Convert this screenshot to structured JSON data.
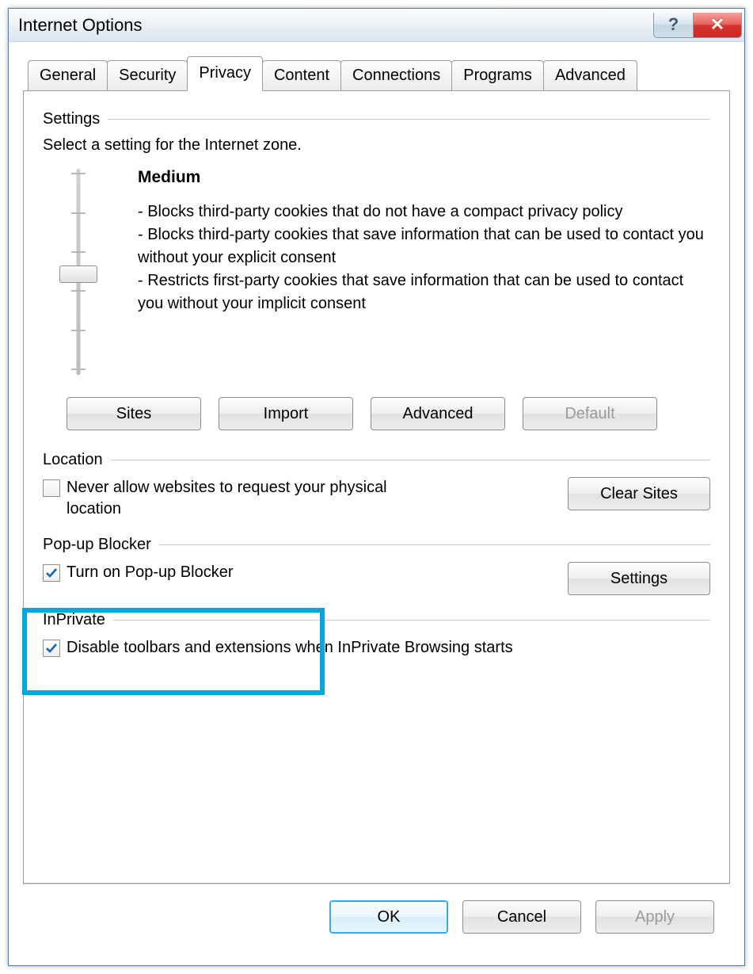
{
  "window": {
    "title": "Internet Options",
    "help_glyph": "?",
    "close_glyph": "✕"
  },
  "tabs": [
    "General",
    "Security",
    "Privacy",
    "Content",
    "Connections",
    "Programs",
    "Advanced"
  ],
  "active_tab_index": 2,
  "settings": {
    "header": "Settings",
    "instruction": "Select a setting for the Internet zone.",
    "level": "Medium",
    "bullets": [
      "- Blocks third-party cookies that do not have a compact privacy policy",
      "- Blocks third-party cookies that save information that can be used to contact you without your explicit consent",
      "- Restricts first-party cookies that save information that can be used to contact you without your implicit consent"
    ],
    "buttons": {
      "sites": "Sites",
      "import": "Import",
      "advanced": "Advanced",
      "default": "Default"
    }
  },
  "location": {
    "header": "Location",
    "label": "Never allow websites to request your physical location",
    "checked": false,
    "button": "Clear Sites"
  },
  "popup": {
    "header": "Pop-up Blocker",
    "label": "Turn on Pop-up Blocker",
    "checked": true,
    "button": "Settings"
  },
  "inprivate": {
    "header": "InPrivate",
    "label": "Disable toolbars and extensions when InPrivate Browsing starts",
    "checked": true
  },
  "dialog_buttons": {
    "ok": "OK",
    "cancel": "Cancel",
    "apply": "Apply"
  }
}
